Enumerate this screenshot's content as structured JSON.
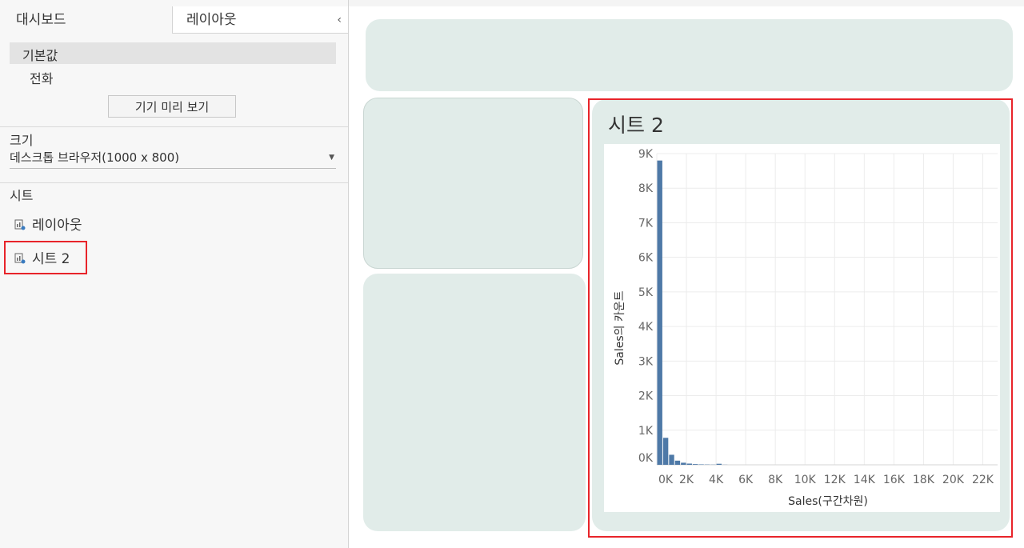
{
  "sidebar": {
    "tabs": [
      "대시보드",
      "레이아웃"
    ],
    "collapse_icon": "chevron-left-icon",
    "device_items": [
      "기본값",
      "전화"
    ],
    "preview_button": "기기 미리 보기",
    "size_label": "크기",
    "size_value": "데스크톱 브라우저(1000 x 800)",
    "sheets_label": "시트",
    "sheets": [
      "레이아웃",
      "시트 2"
    ]
  },
  "dashboard": {
    "sheet_title": "시트 2"
  },
  "colors": {
    "bar": "#4e79a7",
    "tile": "#e1ece9",
    "highlight": "#e8242a"
  },
  "chart_data": {
    "type": "bar",
    "xlabel": "Sales(구간차원)",
    "ylabel": "Sales의 카운트",
    "x_ticks": [
      "0K",
      "2K",
      "4K",
      "6K",
      "8K",
      "10K",
      "12K",
      "14K",
      "16K",
      "18K",
      "20K",
      "22K"
    ],
    "y_ticks": [
      "0K",
      "1K",
      "2K",
      "3K",
      "4K",
      "5K",
      "6K",
      "7K",
      "8K",
      "9K"
    ],
    "ylim": [
      0,
      9000
    ],
    "xlim": [
      0,
      23000
    ],
    "bin_width": 400,
    "bins": [
      0,
      400,
      800,
      1200,
      1600,
      2000,
      2400,
      2800,
      3200,
      3600,
      4000,
      4400
    ],
    "values": [
      8800,
      780,
      290,
      120,
      60,
      35,
      20,
      12,
      8,
      5,
      30,
      3
    ],
    "grid": true
  }
}
